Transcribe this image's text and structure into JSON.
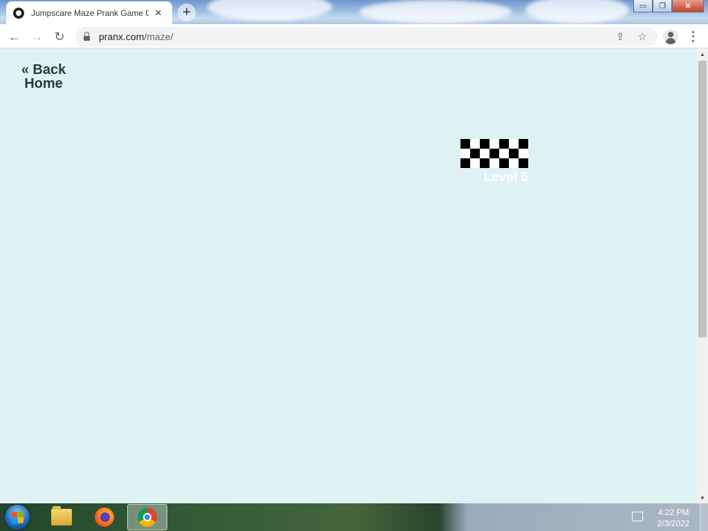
{
  "browser": {
    "tab": {
      "title": "Jumpscare Maze Prank Game Online",
      "close_glyph": "✕"
    },
    "new_tab_glyph": "+",
    "window_buttons": {
      "minimize": "▭",
      "restore": "❐",
      "close": "✕"
    },
    "toolbar": {
      "back_glyph": "←",
      "forward_glyph": "→",
      "reload_glyph": "↻",
      "url_domain": "pranx.com",
      "url_path": "/maze/",
      "share_glyph": "⇪",
      "bookmark_glyph": "☆"
    }
  },
  "page": {
    "background_color": "#dff2f3",
    "back_home": "« Back Home",
    "level_label": "Level 6"
  },
  "scrollbar": {
    "up_glyph": "▲",
    "down_glyph": "▼"
  },
  "taskbar": {
    "apps": [
      "windows-explorer",
      "firefox",
      "chrome"
    ],
    "active_app": "chrome",
    "clock_time": "4:22 PM",
    "clock_date": "2/3/2022"
  }
}
